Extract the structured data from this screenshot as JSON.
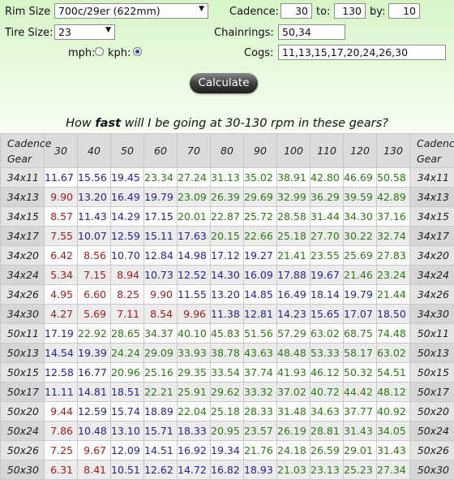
{
  "form": {
    "rim_size_label": "Rim Size",
    "rim_size_value": "700c/29er (622mm)",
    "tire_size_label": "Tire Size:",
    "tire_size_value": "23",
    "mph_label": "mph:",
    "kph_label": "kph:",
    "speed_unit_selected": "kph",
    "cadence_label": "Cadence:",
    "cadence_from": "30",
    "to_label": "to:",
    "cadence_to": "130",
    "by_label": "by:",
    "cadence_step": "10",
    "chainrings_label": "Chainrings:",
    "chainrings_value": "50,34",
    "cogs_label": "Cogs:",
    "cogs_value": "11,13,15,17,20,24,26,30",
    "calculate_label": "Calculate"
  },
  "question": {
    "before": "How ",
    "emphasis": "fast",
    "after": " will I be going at 30-130 rpm in these gears?"
  },
  "table": {
    "corner_top": "Cadence",
    "corner_bottom": "Gear",
    "cadences": [
      "30",
      "40",
      "50",
      "60",
      "70",
      "80",
      "90",
      "100",
      "110",
      "120",
      "130"
    ],
    "colors": {
      "red": "#a61c1c",
      "blue": "#22229a",
      "green": "#2b7a12"
    },
    "rows": [
      {
        "gear": "34x11",
        "values": [
          "11.67",
          "15.56",
          "19.45",
          "23.34",
          "27.24",
          "31.13",
          "35.02",
          "38.91",
          "42.80",
          "46.69",
          "50.58"
        ]
      },
      {
        "gear": "34x13",
        "values": [
          "9.90",
          "13.20",
          "16.49",
          "19.79",
          "23.09",
          "26.39",
          "29.69",
          "32.99",
          "36.29",
          "39.59",
          "42.89"
        ]
      },
      {
        "gear": "34x15",
        "values": [
          "8.57",
          "11.43",
          "14.29",
          "17.15",
          "20.01",
          "22.87",
          "25.72",
          "28.58",
          "31.44",
          "34.30",
          "37.16"
        ]
      },
      {
        "gear": "34x17",
        "values": [
          "7.55",
          "10.07",
          "12.59",
          "15.11",
          "17.63",
          "20.15",
          "22.66",
          "25.18",
          "27.70",
          "30.22",
          "32.74"
        ]
      },
      {
        "gear": "34x20",
        "values": [
          "6.42",
          "8.56",
          "10.70",
          "12.84",
          "14.98",
          "17.12",
          "19.27",
          "21.41",
          "23.55",
          "25.69",
          "27.83"
        ]
      },
      {
        "gear": "34x24",
        "values": [
          "5.34",
          "7.15",
          "8.94",
          "10.73",
          "12.52",
          "14.30",
          "16.09",
          "17.88",
          "19.67",
          "21.46",
          "23.24"
        ]
      },
      {
        "gear": "34x26",
        "values": [
          "4.95",
          "6.60",
          "8.25",
          "9.90",
          "11.55",
          "13.20",
          "14.85",
          "16.49",
          "18.14",
          "19.79",
          "21.44"
        ]
      },
      {
        "gear": "34x30",
        "values": [
          "4.27",
          "5.69",
          "7.11",
          "8.54",
          "9.96",
          "11.38",
          "12.81",
          "14.23",
          "15.65",
          "17.07",
          "18.50"
        ]
      },
      {
        "gear": "50x11",
        "values": [
          "17.19",
          "22.92",
          "28.65",
          "34.37",
          "40.10",
          "45.83",
          "51.56",
          "57.29",
          "63.02",
          "68.75",
          "74.48"
        ]
      },
      {
        "gear": "50x13",
        "values": [
          "14.54",
          "19.39",
          "24.24",
          "29.09",
          "33.93",
          "38.78",
          "43.63",
          "48.48",
          "53.33",
          "58.17",
          "63.02"
        ]
      },
      {
        "gear": "50x15",
        "values": [
          "12.58",
          "16.77",
          "20.96",
          "25.16",
          "29.35",
          "33.54",
          "37.74",
          "41.93",
          "46.12",
          "50.32",
          "54.51"
        ]
      },
      {
        "gear": "50x17",
        "values": [
          "11.11",
          "14.81",
          "18.51",
          "22.21",
          "25.91",
          "29.62",
          "33.32",
          "37.02",
          "40.72",
          "44.42",
          "48.12"
        ]
      },
      {
        "gear": "50x20",
        "values": [
          "9.44",
          "12.59",
          "15.74",
          "18.89",
          "22.04",
          "25.18",
          "28.33",
          "31.48",
          "34.63",
          "37.77",
          "40.92"
        ]
      },
      {
        "gear": "50x24",
        "values": [
          "7.86",
          "10.48",
          "13.10",
          "15.71",
          "18.33",
          "20.95",
          "23.57",
          "26.19",
          "28.81",
          "31.43",
          "34.05"
        ]
      },
      {
        "gear": "50x26",
        "values": [
          "7.25",
          "9.67",
          "12.09",
          "14.51",
          "16.92",
          "19.34",
          "21.76",
          "24.18",
          "26.59",
          "29.01",
          "31.43"
        ]
      },
      {
        "gear": "50x30",
        "values": [
          "6.31",
          "8.41",
          "10.51",
          "12.62",
          "14.72",
          "16.82",
          "18.93",
          "21.03",
          "23.13",
          "25.23",
          "27.34"
        ]
      }
    ]
  }
}
